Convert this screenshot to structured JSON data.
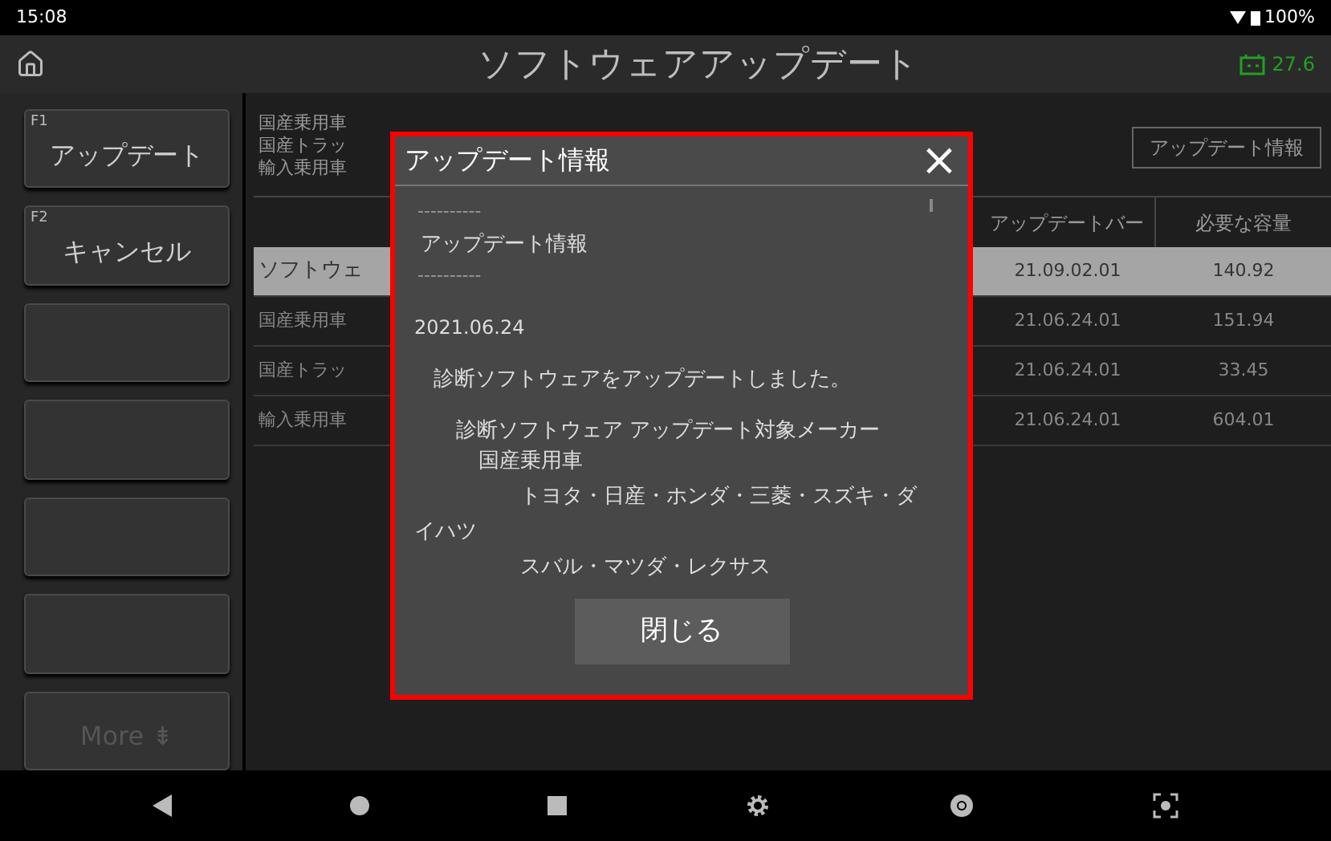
{
  "status_bar": {
    "time": "15:08",
    "battery": "100%"
  },
  "header": {
    "title": "ソフトウェアアップデート",
    "voltage": "27.6"
  },
  "side_buttons": [
    {
      "kind": "labeled",
      "key": "F1",
      "label": "アップデート",
      "disabled": false
    },
    {
      "kind": "labeled",
      "key": "F2",
      "label": "キャンセル",
      "disabled": false
    },
    {
      "kind": "blank"
    },
    {
      "kind": "blank"
    },
    {
      "kind": "blank"
    },
    {
      "kind": "blank"
    },
    {
      "kind": "labeled",
      "label": "More ⇟",
      "disabled": true
    }
  ],
  "info_lines": [
    "国産乗用車",
    "国産トラッ",
    "輸入乗用車"
  ],
  "info_button": "アップデート情報",
  "table": {
    "columns": [
      "アップデートバー",
      "必要な容量"
    ],
    "rows": [
      {
        "name": "ソフトウェ",
        "version": "21.09.02.01",
        "size": "140.92",
        "selected": true
      },
      {
        "name": "国産乗用車",
        "version": "21.06.24.01",
        "size": "151.94",
        "selected": false
      },
      {
        "name": "国産トラッ",
        "version": "21.06.24.01",
        "size": "33.45",
        "selected": false
      },
      {
        "name": "輸入乗用車",
        "version": "21.06.24.01",
        "size": "604.01",
        "selected": false
      }
    ]
  },
  "dialog": {
    "title": "アップデート情報",
    "close": "×",
    "lines": [
      {
        "kind": "rule",
        "text": "----------"
      },
      {
        "kind": "heading",
        "text": "アップデート情報"
      },
      {
        "kind": "rule",
        "text": "----------"
      },
      {
        "kind": "date",
        "text": "2021.06.24"
      },
      {
        "kind": "para",
        "text": "診断ソフトウェアをアップデートしました。"
      },
      {
        "kind": "l1",
        "text": "診断ソフトウェア アップデート対象メーカー"
      },
      {
        "kind": "l2",
        "text": "国産乗用車"
      },
      {
        "kind": "l3",
        "text": "トヨタ・日産・ホンダ・三菱・スズキ・ダ"
      },
      {
        "kind": "l0",
        "text": "イハツ"
      },
      {
        "kind": "l3",
        "text": "スバル・マツダ・レクサス"
      }
    ],
    "button": "閉じる"
  }
}
